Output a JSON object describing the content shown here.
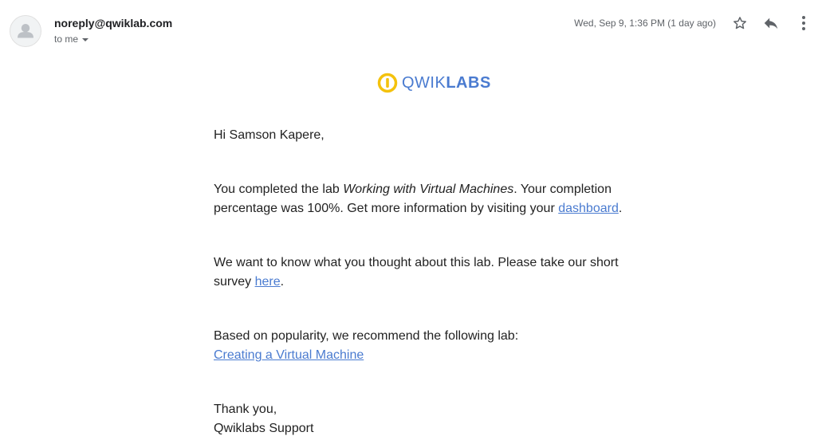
{
  "header": {
    "sender": "noreply@qwiklab.com",
    "recipient": "to me",
    "timestamp": "Wed, Sep 9, 1:36 PM (1 day ago)",
    "icons": [
      "avatar-icon",
      "star-icon",
      "reply-icon",
      "more-vert-icon"
    ]
  },
  "logo": {
    "text_light": "QWIK",
    "text_bold": "LABS",
    "brand_color": "#4a7bd0",
    "mark_color": "#f4c20d"
  },
  "body": {
    "greeting": "Hi Samson Kapere,",
    "p1_pre": "You completed the lab ",
    "p1_lab": "Working with Virtual Machines",
    "p1_mid": ". Your completion percentage was 100%. Get more information by visiting your ",
    "p1_link": "dashboard",
    "p1_end": ".",
    "p2_pre": "We want to know what you thought about this lab. Please take our short survey ",
    "p2_link": "here",
    "p2_end": ".",
    "p3_text": "Based on popularity, we recommend the following lab:",
    "p3_link": "Creating a Virtual Machine",
    "closing": "Thank you,",
    "signature": "Qwiklabs Support"
  },
  "colors": {
    "link": "#4a7bd0",
    "text": "#222222",
    "muted": "#5f6368"
  }
}
